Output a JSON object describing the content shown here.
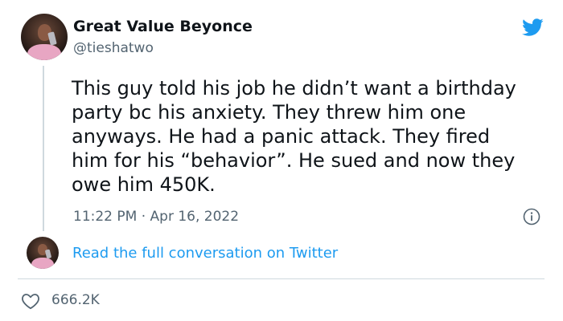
{
  "tweet": {
    "display_name": "Great Value Beyonce",
    "handle": "@tieshatwo",
    "text": "This guy told his job he didn’t want a birthday\nparty bc his anxiety. They threw him one\nanyways. He had a panic attack. They fired\nhim for his “behavior”. He sued and now they\nowe him 450K.",
    "timestamp": "11:22 PM · Apr 16, 2022",
    "read_more_label": "Read the full conversation on Twitter",
    "likes": "666.2K"
  },
  "icons": {
    "logo": "twitter-bird-icon",
    "info": "info-icon",
    "like": "heart-icon"
  },
  "colors": {
    "brand_blue": "#1d9bf0",
    "text_primary": "#0f1419",
    "text_secondary": "#536471",
    "divider": "#cfd9de"
  }
}
